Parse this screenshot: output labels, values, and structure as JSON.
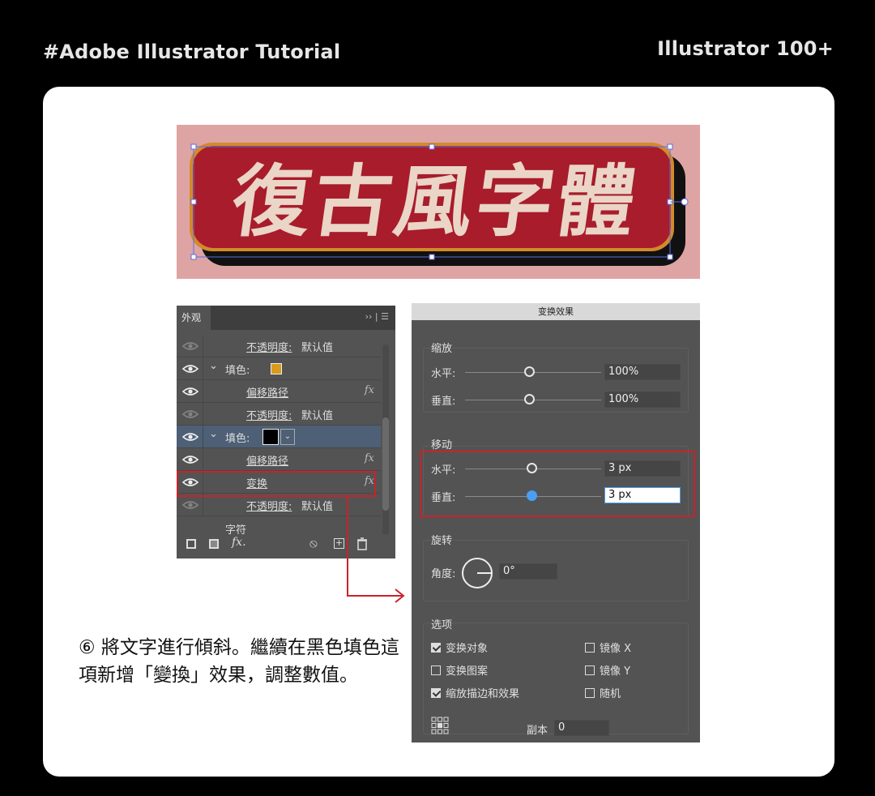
{
  "header": {
    "left": "#Adobe Illustrator Tutorial",
    "right": "Illustrator 100+"
  },
  "banner": {
    "text": "復古風字體",
    "bg_color": "#dea4a3",
    "fill_color": "#ead5c6",
    "stroke_color": "#a81c2c",
    "outline_color": "#d38a2a"
  },
  "appearance": {
    "tab": "外观",
    "rows": [
      {
        "label_prefix": "",
        "label": "不透明度:",
        "value": "默认值",
        "fx": "",
        "indent": "sub",
        "dim": true
      },
      {
        "label_prefix": "⌄",
        "label": "填色:",
        "value": "",
        "fx": "",
        "indent": "top",
        "swatch": "#d99a1e"
      },
      {
        "label_prefix": "",
        "label": "偏移路径",
        "value": "",
        "fx": "fx",
        "indent": "sub"
      },
      {
        "label_prefix": "",
        "label": "不透明度:",
        "value": "默认值",
        "fx": "",
        "indent": "sub",
        "dim": true
      },
      {
        "label_prefix": "⌄",
        "label": "填色:",
        "value": "",
        "fx": "",
        "indent": "top",
        "swatch": "#000000",
        "selected": true
      },
      {
        "label_prefix": "",
        "label": "偏移路径",
        "value": "",
        "fx": "fx",
        "indent": "sub"
      },
      {
        "label_prefix": "",
        "label": "变换",
        "value": "",
        "fx": "fx",
        "indent": "sub"
      },
      {
        "label_prefix": "",
        "label": "不透明度:",
        "value": "默认值",
        "fx": "",
        "indent": "sub",
        "dim": true
      }
    ],
    "char_label": "字符",
    "fx_button": "fx."
  },
  "transform": {
    "title": "变换效果",
    "scale": {
      "label": "缩放",
      "h_label": "水平:",
      "h_value": "100%",
      "v_label": "垂直:",
      "v_value": "100%"
    },
    "move": {
      "label": "移动",
      "h_label": "水平:",
      "h_value": "3 px",
      "v_label": "垂直:",
      "v_value": "3 px"
    },
    "rotate": {
      "label": "旋转",
      "angle_label": "角度:",
      "angle_value": "0°"
    },
    "options": {
      "label": "选项",
      "transform_objects": "变换对象",
      "transform_patterns": "变换图案",
      "scale_strokes": "缩放描边和效果",
      "mirror_x": "镜像 X",
      "mirror_y": "镜像 Y",
      "random": "随机"
    },
    "copies_label": "副本",
    "copies_value": "0"
  },
  "caption": "⑥ 將文字進行傾斜。繼續在黑色填色這項新增「變換」效果，調整數值。"
}
